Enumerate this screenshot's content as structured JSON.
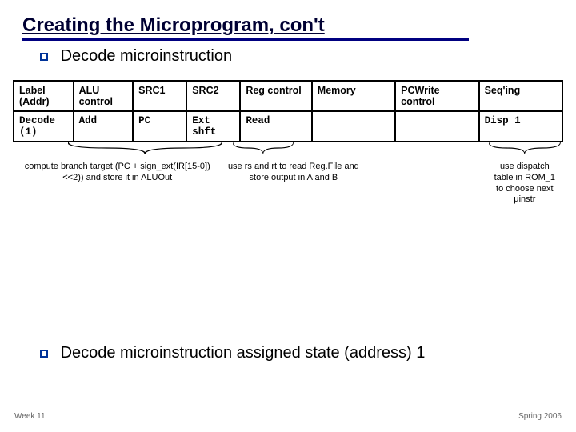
{
  "title": "Creating the Microprogram, con't",
  "bullet_top": "Decode microinstruction",
  "table": {
    "headers": [
      "Label (Addr)",
      "ALU control",
      "SRC1",
      "SRC2",
      "Reg control",
      "Memory",
      "PCWrite control",
      "Seq'ing"
    ],
    "row": {
      "label": "Decode",
      "addr": "(1)",
      "alu": "Add",
      "src1": "PC",
      "src2": "Ext shft",
      "reg": "Read",
      "memory": "",
      "pcwrite": "",
      "seq": "Disp 1"
    }
  },
  "annotations": {
    "a1": "compute branch target (PC +  sign_ext(IR[15-0])<<2)) and store it in ALUOut",
    "a2": "use rs and rt to read Reg.File and store output in A and B",
    "a3": "",
    "a4": "use dispatch table in ROM_1 to choose next μinstr"
  },
  "bullet_bottom": "Decode microinstruction assigned state (address) 1",
  "footer_left": "Week 11",
  "footer_right": "Spring 2006"
}
